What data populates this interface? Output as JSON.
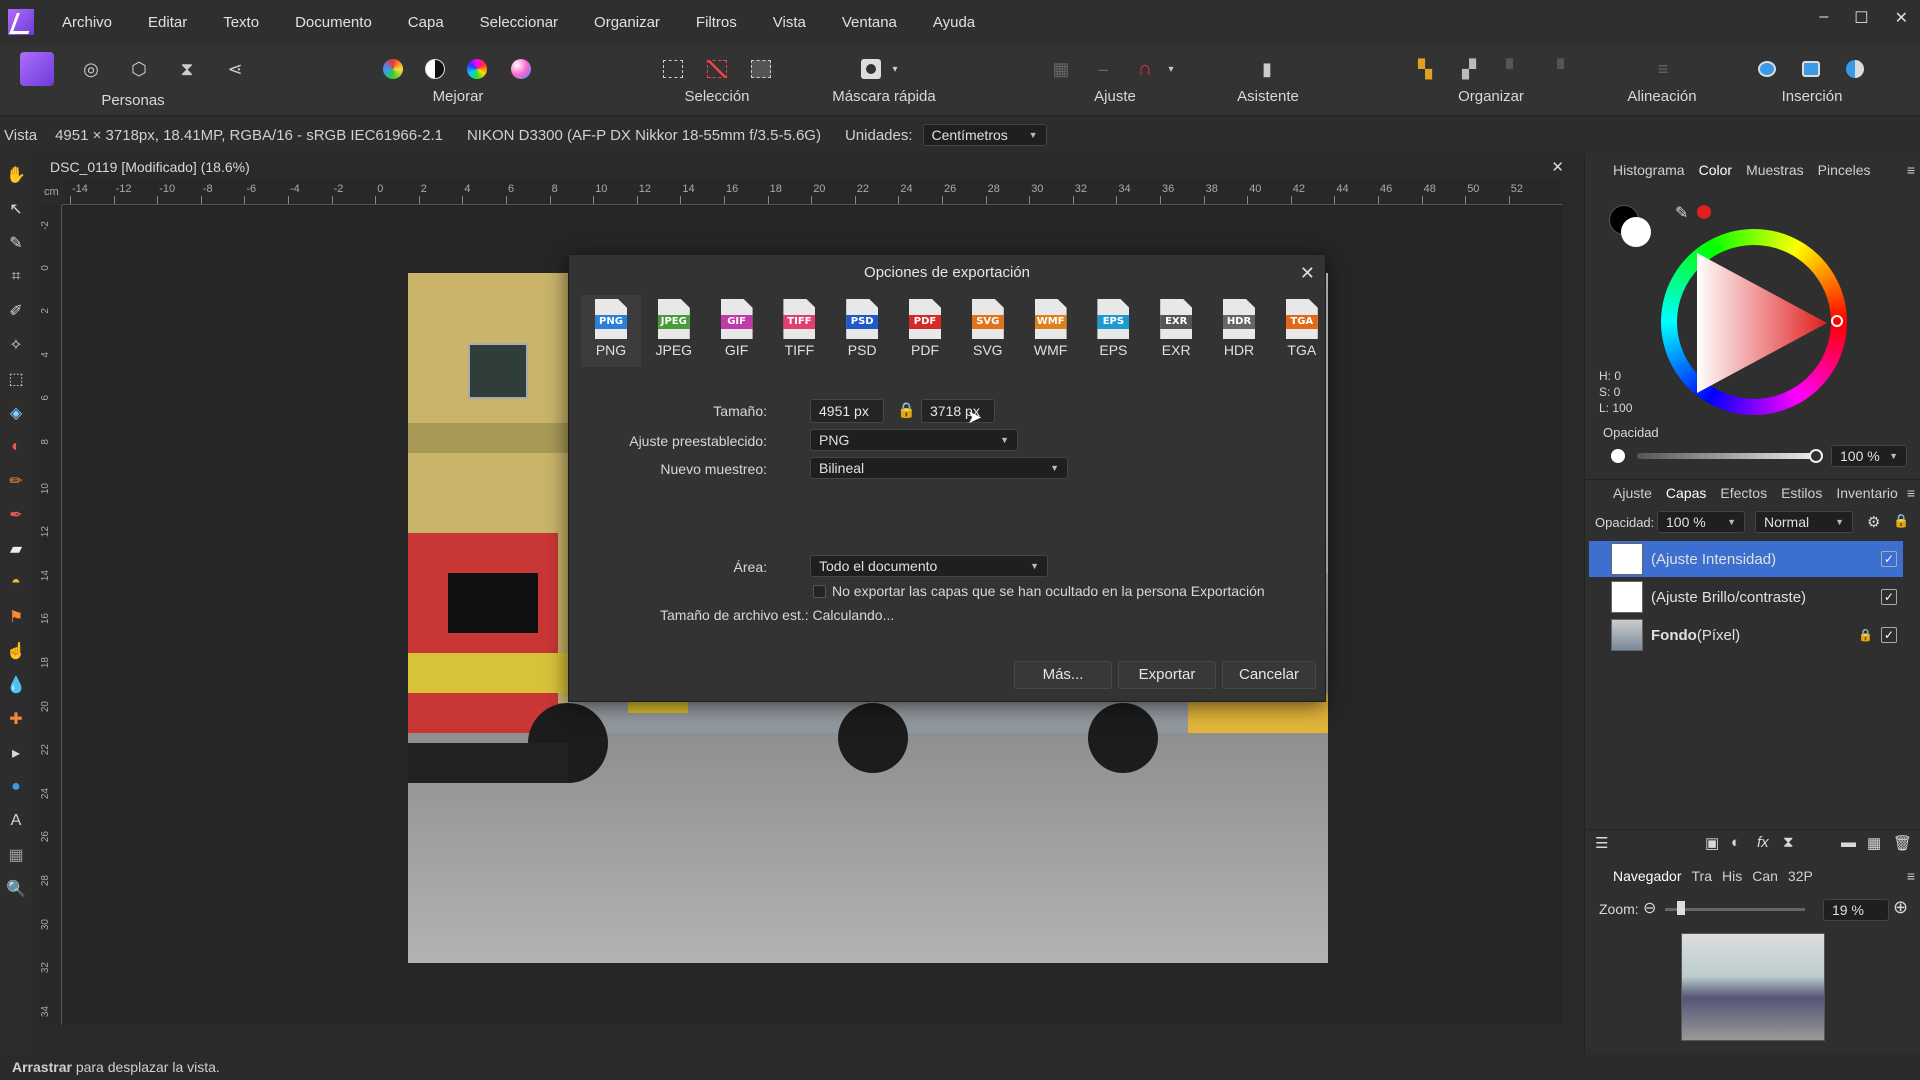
{
  "menu": {
    "items": [
      "Archivo",
      "Editar",
      "Texto",
      "Documento",
      "Capa",
      "Seleccionar",
      "Organizar",
      "Filtros",
      "Vista",
      "Ventana",
      "Ayuda"
    ],
    "window_controls": {
      "minimize": "–",
      "maximize": "☐",
      "close": "✕"
    }
  },
  "toolbar": {
    "groups": {
      "personas": "Personas",
      "mejorar": "Mejorar",
      "seleccion": "Selección",
      "mascara": "Máscara rápida",
      "ajuste": "Ajuste",
      "asistente": "Asistente",
      "organizar": "Organizar",
      "alineacion": "Alineación",
      "insercion": "Inserción"
    }
  },
  "context": {
    "vista": "Vista",
    "image_info": "4951 × 3718px, 18.41MP, RGBA/16 - sRGB IEC61966-2.1",
    "camera": "NIKON D3300 (AF-P DX Nikkor 18-55mm f/3.5-5.6G)",
    "units_label": "Unidades:",
    "units_value": "Centímetros"
  },
  "document": {
    "tab_title": "DSC_0119 [Modificado] (18.6%)",
    "close": "✕",
    "ruler_unit": "cm",
    "top_ruler": [
      "-14",
      "-12",
      "-10",
      "-8",
      "-6",
      "-4",
      "-2",
      "0",
      "2",
      "4",
      "6",
      "8",
      "10",
      "12",
      "14",
      "16",
      "18",
      "20",
      "22",
      "24",
      "26",
      "28",
      "30",
      "32",
      "34",
      "36",
      "38",
      "40",
      "42",
      "44",
      "46",
      "48",
      "50",
      "52"
    ],
    "left_ruler": [
      "-2",
      "0",
      "2",
      "4",
      "6",
      "8",
      "10",
      "12",
      "14",
      "16",
      "18",
      "20",
      "22",
      "24",
      "26",
      "28",
      "30",
      "32",
      "34"
    ]
  },
  "export_dialog": {
    "title": "Opciones de exportación",
    "close": "✕",
    "formats": [
      {
        "label": "PNG",
        "color": "#2b7fd6"
      },
      {
        "label": "JPEG",
        "color": "#4a9b3a"
      },
      {
        "label": "GIF",
        "color": "#c03aa8"
      },
      {
        "label": "TIFF",
        "color": "#e04070"
      },
      {
        "label": "PSD",
        "color": "#1e5bc6"
      },
      {
        "label": "PDF",
        "color": "#d52a2a"
      },
      {
        "label": "SVG",
        "color": "#e0731c"
      },
      {
        "label": "WMF",
        "color": "#e0801c"
      },
      {
        "label": "EPS",
        "color": "#1f9ad0"
      },
      {
        "label": "EXR",
        "color": "#555555"
      },
      {
        "label": "HDR",
        "color": "#666666"
      },
      {
        "label": "TGA",
        "color": "#e06a1a"
      }
    ],
    "selected_format": "PNG",
    "size_label": "Tamaño:",
    "width": "4951 px",
    "height": "3718 px",
    "preset_label": "Ajuste preestablecido:",
    "preset_value": "PNG",
    "resample_label": "Nuevo muestreo:",
    "resample_value": "Bilineal",
    "area_label": "Área:",
    "area_value": "Todo el documento",
    "hidden_layers_text": "No exportar las capas que se han ocultado en la persona Exportación",
    "filesize_text": "Tamaño de archivo est.: Calculando...",
    "buttons": {
      "more": "Más...",
      "export": "Exportar",
      "cancel": "Cancelar"
    }
  },
  "color_panel": {
    "tabs": [
      "Histograma",
      "Color",
      "Muestras",
      "Pinceles"
    ],
    "active_tab": "Color",
    "h": "H: 0",
    "s": "S: 0",
    "l": "L: 100",
    "opacity_label": "Opacidad",
    "opacity_value": "100 %"
  },
  "layers_panel": {
    "tabs": [
      "Ajuste",
      "Capas",
      "Efectos",
      "Estilos",
      "Inventario"
    ],
    "active_tab": "Capas",
    "opacity_label": "Opacidad:",
    "opacity_value": "100 %",
    "blend_mode": "Normal",
    "layers": [
      {
        "name": "(Ajuste Intensidad)",
        "selected": true
      },
      {
        "name": "(Ajuste Brillo/contraste)",
        "selected": false
      },
      {
        "name": "Fondo",
        "suffix": " (Píxel)",
        "selected": false,
        "locked": true
      }
    ]
  },
  "navigator_panel": {
    "tabs": [
      "Navegador",
      "Tra",
      "His",
      "Can",
      "32P"
    ],
    "active_tab": "Navegador",
    "zoom_label": "Zoom:",
    "zoom_value": "19 %"
  },
  "status": {
    "bold": "Arrastrar",
    "rest": " para desplazar la vista."
  }
}
